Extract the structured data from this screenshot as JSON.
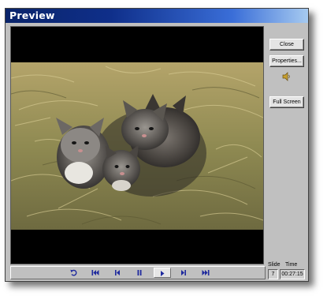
{
  "window": {
    "title": "Preview"
  },
  "side_panel": {
    "close_label": "Close",
    "properties_label": "Properties...",
    "speaker_icon": "speaker-icon",
    "full_screen_label": "Full Screen",
    "slide_label": "Slide",
    "slide_value": "7",
    "time_label": "Time",
    "time_value": "00:27:15"
  },
  "controls": {
    "buttons": [
      "rewind-loop-icon",
      "first-slide-icon",
      "previous-slide-icon",
      "pause-icon",
      "play-icon",
      "next-slide-icon",
      "last-slide-icon"
    ],
    "active": "play-icon",
    "icon_color": "#1f2a9e"
  },
  "colors": {
    "title_bar_start": "#0a246a",
    "title_bar_end": "#a6caf0",
    "window_face": "#c0c0c0"
  }
}
